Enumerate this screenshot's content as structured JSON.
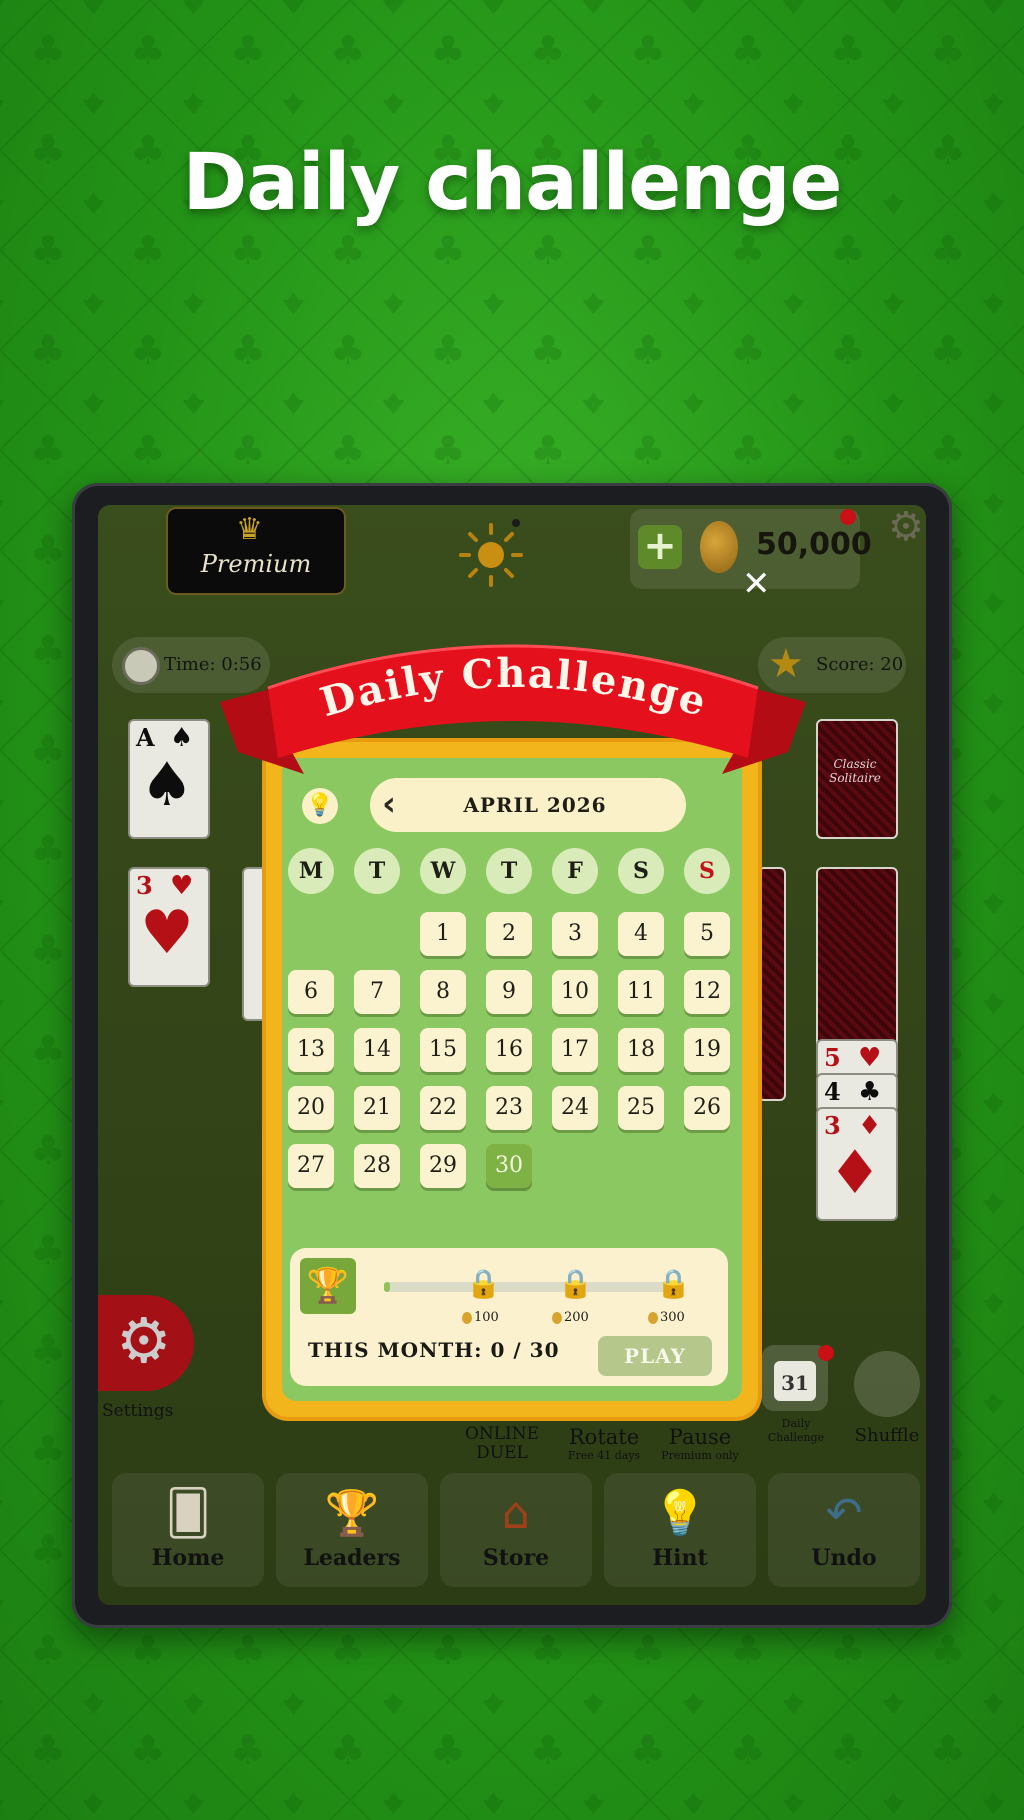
{
  "headline": "Daily challenge",
  "top_bar": {
    "premium_label": "Premium",
    "coins": "50,000",
    "time": "Time: 0:56",
    "score": "Score: 20"
  },
  "card_back_label": [
    "Classic",
    "Solitaire"
  ],
  "cards": {
    "foundation_rank": "A",
    "tableau_rank": "3",
    "right_stack_ranks": [
      "5",
      "4",
      "3"
    ]
  },
  "settings_label": "Settings",
  "actions": {
    "online_duel": [
      "ONLINE",
      "DUEL"
    ],
    "rotate": "Rotate",
    "rotate_note": "Free 41 days",
    "pause": "Pause",
    "pause_note": "Premium only",
    "daily_challenge": [
      "Daily",
      "Challenge"
    ],
    "daily_badge": "31",
    "shuffle": "Shuffle"
  },
  "nav": {
    "items": [
      {
        "label": "Home",
        "icon": "cards-icon"
      },
      {
        "label": "Leaders",
        "icon": "podium-icon"
      },
      {
        "label": "Store",
        "icon": "store-icon"
      },
      {
        "label": "Hint",
        "icon": "bulb-icon"
      },
      {
        "label": "Undo",
        "icon": "undo-icon"
      }
    ]
  },
  "modal": {
    "title": "Daily Challenge",
    "month": "APRIL 2026",
    "weekdays": [
      "M",
      "T",
      "W",
      "T",
      "F",
      "S",
      "S"
    ],
    "first_weekday_index": 2,
    "days_in_month": 30,
    "selected_day": 30,
    "milestones": [
      "100",
      "200",
      "300"
    ],
    "progress_label": "THIS MONTH: 0 / 30",
    "progress_fraction": 0,
    "play_label": "PLAY"
  },
  "colors": {
    "background": "#2a9a1c",
    "modal_frame": "#f2b51b",
    "modal_fill": "#8bc861",
    "ribbon": "#e4111d",
    "today": "#7fb244"
  }
}
